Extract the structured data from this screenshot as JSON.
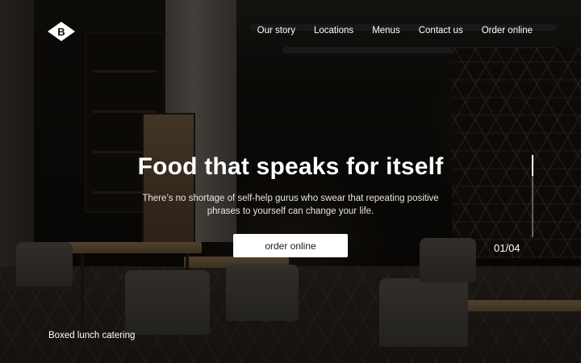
{
  "brand": {
    "logo_letter": "B"
  },
  "nav": {
    "items": [
      {
        "label": "Our story"
      },
      {
        "label": "Locations"
      },
      {
        "label": "Menus"
      },
      {
        "label": "Contact us"
      },
      {
        "label": "Order online"
      }
    ]
  },
  "hero": {
    "title": "Food that speaks for itself",
    "subtitle": "There’s no shortage of self-help gurus who swear that repeating positive phrases to yourself can change your life.",
    "cta_label": "order online"
  },
  "slider": {
    "counter": "01/04",
    "current": 1,
    "total": 4
  },
  "footer": {
    "catering_link": "Boxed lunch catering"
  },
  "colors": {
    "text": "#ffffff",
    "button_bg": "#ffffff",
    "button_text": "#1a1a1a"
  },
  "icons": {
    "logo": "b-diamond-logo-icon"
  }
}
